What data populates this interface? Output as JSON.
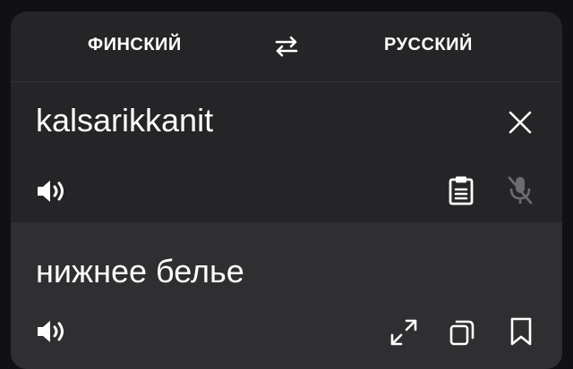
{
  "languages": {
    "source": "ФИНСКИЙ",
    "target": "РУССКИЙ"
  },
  "source": {
    "text": "kalsarikkanit"
  },
  "translation": {
    "text": "нижнее белье"
  },
  "icons": {
    "swap": "swap-arrows-icon",
    "clear": "close-icon",
    "speaker_source": "speaker-icon",
    "paste": "clipboard-icon",
    "mic": "mic-off-icon",
    "speaker_target": "speaker-icon",
    "expand": "expand-icon",
    "copy": "copy-icon",
    "bookmark": "bookmark-icon"
  },
  "colors": {
    "card": "#252527",
    "translation_panel": "#2f2f32",
    "text": "#ffffff",
    "icon_dim": "#6b6b70"
  }
}
